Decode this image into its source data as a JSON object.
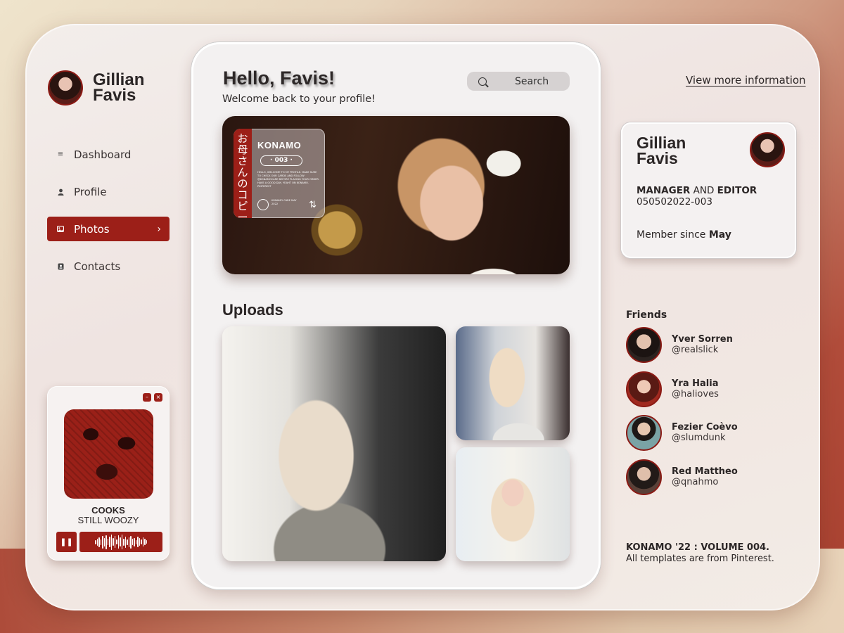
{
  "user": {
    "name": "Gillian Favis"
  },
  "nav": {
    "items": [
      {
        "label": "Dashboard",
        "icon": "menu-icon"
      },
      {
        "label": "Profile",
        "icon": "person-icon"
      },
      {
        "label": "Photos",
        "icon": "image-icon",
        "active": true
      },
      {
        "label": "Contacts",
        "icon": "contacts-icon"
      }
    ]
  },
  "player": {
    "title": "COOKS",
    "artist": "STILL WOOZY",
    "minimize": "–",
    "close": "×",
    "play_icon": "pause-icon"
  },
  "main": {
    "greeting": "Hello, Favis!",
    "welcome": "Welcome back to your profile!",
    "search": {
      "label": "Search"
    },
    "hero_tag": {
      "side_text": "お母さんのコピー",
      "title": "KONAMO",
      "number": "· 003 ·",
      "body": "HELLO, WELCOME TO MY PROFILE. MAKE SURE TO CHECK OUR CARDS AND FOLLOW @KONAMOCARE BEFORE PLACING YOUR ORDER. HAVE A GOOD DAY, YEAHT ON KONAMO. PINTEREST",
      "footer": "KONAMO CARE MAY 2022"
    },
    "uploads_title": "Uploads"
  },
  "profile_card": {
    "link": "View more information",
    "name": "Gillian Favis",
    "role_bold": "MANAGER",
    "role_mid": "AND",
    "role_end": "EDITOR",
    "id": "050502022-003",
    "since_label": "Member since",
    "since_value": "May"
  },
  "friends": {
    "title": "Friends",
    "list": [
      {
        "name": "Yver Sorren",
        "handle": "@realslick"
      },
      {
        "name": "Yra Halia",
        "handle": "@halioves"
      },
      {
        "name": "Fezier Coèvo",
        "handle": "@slumdunk"
      },
      {
        "name": "Red Mattheo",
        "handle": "@qnahmo"
      }
    ]
  },
  "footer": {
    "title": "KONAMO '22 : VOLUME 004.",
    "note": "All templates are from Pinterest."
  },
  "colors": {
    "accent": "#9c1f18",
    "panel": "#f3f1f1"
  }
}
